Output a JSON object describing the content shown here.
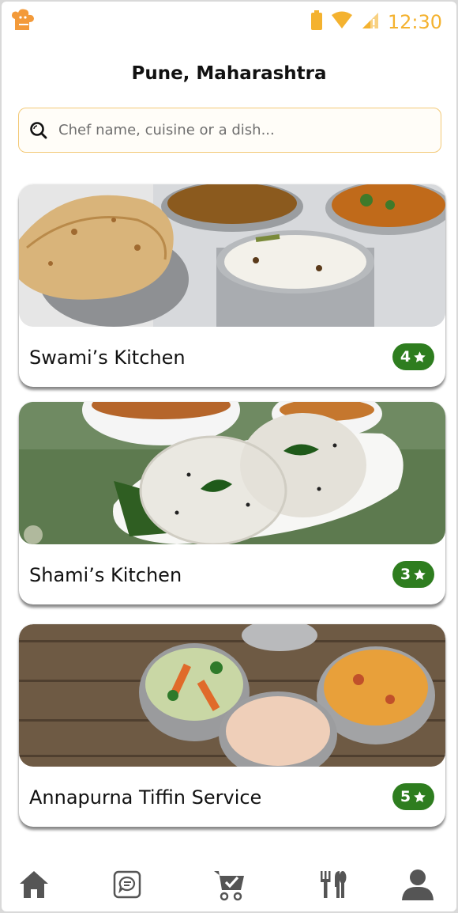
{
  "status_bar": {
    "time": "12:30",
    "icons": [
      "battery-icon",
      "wifi-icon",
      "cellular-signal-icon"
    ],
    "accent_color": "#f4b22f"
  },
  "header": {
    "location": "Pune, Maharashtra"
  },
  "search": {
    "placeholder": "Chef name, cuisine or a dish..."
  },
  "kitchens": [
    {
      "name": "Swami’s Kitchen",
      "rating": "4",
      "image": "chapati-rice-tiffin-photo"
    },
    {
      "name": "Shami’s Kitchen",
      "rating": "3",
      "image": "idli-sambar-photo"
    },
    {
      "name": "Annapurna Tiffin Service",
      "rating": "5",
      "image": "tiffin-boxes-photo"
    }
  ],
  "bottom_nav": {
    "items": [
      "home-icon",
      "chat-icon",
      "cart-check-icon",
      "restaurant-icon",
      "profile-icon"
    ]
  },
  "colors": {
    "rating_badge": "#2e7d1f",
    "search_border": "#f3c977",
    "nav_icon": "#555555"
  }
}
